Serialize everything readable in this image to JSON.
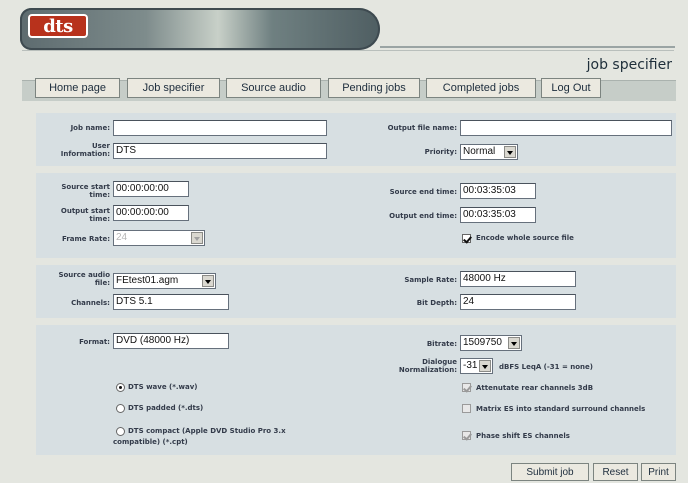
{
  "logo": {
    "text": "dts"
  },
  "page_title": "job specifier",
  "nav": {
    "items": [
      "Home page",
      "Job specifier",
      "Source audio",
      "Pending jobs",
      "Completed jobs",
      "Log Out"
    ]
  },
  "job": {
    "job_name_label": "Job name:",
    "job_name_value": "",
    "user_info_label": [
      "User",
      "Information:"
    ],
    "user_info_value": "DTS",
    "output_file_label": "Output file name:",
    "output_file_value": "",
    "priority_label": "Priority:",
    "priority_value": "Normal"
  },
  "timing": {
    "source_start_label": [
      "Source start",
      "time:"
    ],
    "source_start_value": "00:00:00:00",
    "output_start_label": [
      "Output start",
      "time:"
    ],
    "output_start_value": "00:00:00:00",
    "frame_rate_label": "Frame Rate:",
    "frame_rate_value": "24",
    "source_end_label": "Source end time:",
    "source_end_value": "00:03:35:03",
    "output_end_label": "Output end time:",
    "output_end_value": "00:03:35:03",
    "encode_whole_label": "Encode whole source file",
    "encode_whole_checked": true
  },
  "audio": {
    "source_file_label": [
      "Source audio",
      "file:"
    ],
    "source_file_value": "FEtest01.agm",
    "channels_label": "Channels:",
    "channels_value": "DTS 5.1",
    "sample_rate_label": "Sample Rate:",
    "sample_rate_value": "48000 Hz",
    "bit_depth_label": "Bit Depth:",
    "bit_depth_value": "24"
  },
  "format": {
    "format_label": "Format:",
    "format_value": "DVD (48000 Hz)",
    "bitrate_label": "Bitrate:",
    "bitrate_value": "1509750",
    "dialogue_label": [
      "Dialogue",
      "Normalization:"
    ],
    "dialogue_value": "-31",
    "dialogue_unit": "dBFS LeqA (-31 = none)",
    "radio_options": [
      "DTS wave (*.wav)",
      "DTS padded (*.dts)",
      "DTS compact (Apple DVD Studio Pro 3.x",
      "compatible) (*.cpt)"
    ],
    "selected_radio": 0,
    "checkboxes": [
      "Attenutate rear channels 3dB",
      "Matrix ES into standard surround channels",
      "Phase shift ES channels"
    ]
  },
  "actions": {
    "submit": "Submit job",
    "reset": "Reset",
    "print": "Print"
  },
  "colors": {
    "accent": "#b8321c",
    "panel": "#d7dfe2",
    "background": "#e4e6e0"
  }
}
